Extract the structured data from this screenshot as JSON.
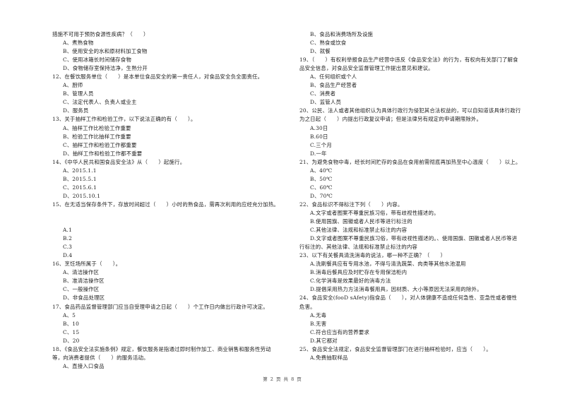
{
  "document": {
    "left_column": [
      {
        "type": "q",
        "text": "措施不可用于预防食源性疾病？（　　）"
      },
      {
        "type": "opt",
        "text": "A、煮熟食物"
      },
      {
        "type": "opt",
        "text": "B、使用安全的水和原材料加工食物"
      },
      {
        "type": "opt",
        "text": "C、使用冰箱长时间储存食物"
      },
      {
        "type": "opt",
        "text": "D、食物储存室保持洁净，生熟分开"
      },
      {
        "type": "q",
        "text": "12、在餐饮服务单位（　　）是本单位食品安全的第一责任人，对食品安全负全面责任。"
      },
      {
        "type": "opt",
        "text": "A、厨师"
      },
      {
        "type": "opt",
        "text": "B、管理人员"
      },
      {
        "type": "opt",
        "text": "C、法定代表人、负责人或业主"
      },
      {
        "type": "opt",
        "text": "D、服务员"
      },
      {
        "type": "q",
        "text": "13、关于抽样工作和检验工作，以下说法正确的有（　　）。"
      },
      {
        "type": "opt",
        "text": "A、抽样工作比检验工作重要"
      },
      {
        "type": "opt",
        "text": "B、检验工作比抽样工作重要"
      },
      {
        "type": "opt",
        "text": "C、抽样工作和检验工作都重要"
      },
      {
        "type": "opt",
        "text": "D、抽样工作和检验工作都不重要"
      },
      {
        "type": "q",
        "text": "14、《中华人民共和国食品安全法》从（　　）起施行。"
      },
      {
        "type": "opt",
        "text": "A、2015.1.1"
      },
      {
        "type": "opt",
        "text": "B、2015.5.1"
      },
      {
        "type": "opt",
        "text": "C、2015.6.1"
      },
      {
        "type": "opt",
        "text": "D、2015.10.1"
      },
      {
        "type": "q",
        "text": "15、在无适当保存条件下，存放时间超过（　　）小时的熟食品，需再次利用的应经充分加热。"
      },
      {
        "type": "blank",
        "text": ""
      },
      {
        "type": "blank",
        "text": ""
      },
      {
        "type": "opt",
        "text": "A.1"
      },
      {
        "type": "opt",
        "text": "B.2"
      },
      {
        "type": "opt",
        "text": "C.3"
      },
      {
        "type": "opt",
        "text": "D.4"
      },
      {
        "type": "q",
        "text": "16、烹饪场所属于（　　）。"
      },
      {
        "type": "opt",
        "text": "A、清洁操作区"
      },
      {
        "type": "opt",
        "text": "B、准清洁操作区"
      },
      {
        "type": "opt",
        "text": "C、一般操作区"
      },
      {
        "type": "opt",
        "text": "D、非食品处理区"
      },
      {
        "type": "q",
        "text": "17、食品药品监督管理部门应当自受理申请之日起（　　）个工作日内做出行政许可决定。"
      },
      {
        "type": "opt",
        "text": "A、5"
      },
      {
        "type": "opt",
        "text": "B、10"
      },
      {
        "type": "opt",
        "text": "C、15"
      },
      {
        "type": "opt",
        "text": "D、20"
      },
      {
        "type": "q",
        "text": "18、《食品安全法实施条例》规定，餐饮服务是指通过即时制作加工、商业销售和服务性劳动"
      },
      {
        "type": "cont",
        "text": "等，向消费者提供（　　）的服务活动。"
      },
      {
        "type": "opt",
        "text": "A、直接入口食品"
      }
    ],
    "right_column": [
      {
        "type": "opt",
        "text": "B、食品和消费场所及设施"
      },
      {
        "type": "opt",
        "text": "C、熟食或饮食"
      },
      {
        "type": "opt",
        "text": "D、就餐"
      },
      {
        "type": "q",
        "text": "19、（　　）有权利举报食品生产经营中违反《食品安全法》的行为，有权向有关部门了解食"
      },
      {
        "type": "cont",
        "text": "品安全信息，对食品安全监督管理工作提出意见和建议。"
      },
      {
        "type": "opt",
        "text": "A、任何组织或个人"
      },
      {
        "type": "opt",
        "text": "B、食品生产经营者"
      },
      {
        "type": "opt",
        "text": "C、消费者"
      },
      {
        "type": "opt",
        "text": "D、监管人员"
      },
      {
        "type": "q",
        "text": "20、公民、法人或者其他组织认为具体行政行为侵犯其合法权益的，可以自知道该具体行政行"
      },
      {
        "type": "cont",
        "text": "为之日起（　　）内提出行政复议申请；但是法律另有规定的申请期限除外。"
      },
      {
        "type": "opt",
        "text": "A.30日"
      },
      {
        "type": "opt",
        "text": "B.60日"
      },
      {
        "type": "opt",
        "text": "C.三个月"
      },
      {
        "type": "opt",
        "text": "D.一年"
      },
      {
        "type": "q",
        "text": "21、为避免食物中毒，经长时间贮存的食品在食用前需彻底再加热至中心温度（　　）以上。"
      },
      {
        "type": "opt",
        "text": "A、40℃"
      },
      {
        "type": "opt",
        "text": "B、50℃"
      },
      {
        "type": "opt",
        "text": "C、60℃"
      },
      {
        "type": "opt",
        "text": "D、70℃"
      },
      {
        "type": "q",
        "text": "22、食品标识不得标注下列（　　）内容。"
      },
      {
        "type": "opt",
        "text": "A.文字或者图案不尊重民族习俗，带有歧视性描述的。"
      },
      {
        "type": "opt",
        "text": "B.使用国旗、国徽或者人民币等进行标注的"
      },
      {
        "type": "opt",
        "text": "C.其他法律、法规和标准禁止标注的内容"
      },
      {
        "type": "opt",
        "text": "D.文字或者图案不尊重民族习俗，带有歧视性描述的。、使用国旗、国徽或者人民币等进"
      },
      {
        "type": "cont",
        "text": "行标注的、其他法律、法规和标准禁止标注的内容"
      },
      {
        "type": "q",
        "text": "23、以下有关餐具清洗消毒的说法，哪一种不正确？（　　）"
      },
      {
        "type": "opt",
        "text": "A.洗刷餐具应有专用水池，不得与清洗蔬菜、肉类等其他水池混用"
      },
      {
        "type": "opt",
        "text": "B.消毒后餐具应及时贮存在专用保洁柜内"
      },
      {
        "type": "opt",
        "text": "C.化学消毒是效果最好的消毒方法"
      },
      {
        "type": "opt",
        "text": "D.提倡采用热力方法消毒餐用具，因材质、大小等原因无法采用的除外。"
      },
      {
        "type": "q",
        "text": "24、食品安全(fooD sAfety)指食品（　　），对人体健康不造成任何急性、亚急性或者慢性"
      },
      {
        "type": "cont",
        "text": "危害。"
      },
      {
        "type": "opt",
        "text": "A.无毒"
      },
      {
        "type": "opt",
        "text": "B.无害"
      },
      {
        "type": "opt",
        "text": "C.符合应当有的营养要求"
      },
      {
        "type": "opt",
        "text": "D.其它都对"
      },
      {
        "type": "q",
        "text": "25、食品安全法规定，食品安全监督管理部门在进行抽样检验时，应当（　　）。"
      },
      {
        "type": "opt",
        "text": "A.免费抽取样品"
      }
    ],
    "footer": "第 2 页 共 8 页"
  }
}
